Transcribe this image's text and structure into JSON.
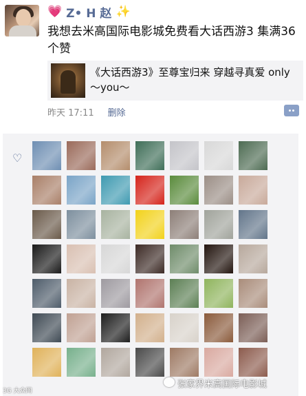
{
  "post": {
    "author": "Z• H 赵",
    "prefix_emoji": "💗",
    "suffix_emoji": "✨",
    "text": "我想去米高国际电影城免费看大话西游3  集满36个赞",
    "link": {
      "title": "《大话西游3》至尊宝归来  穿越寻真爱 only～you～"
    },
    "time": "昨天 17:11",
    "delete_label": "删除"
  },
  "likes": {
    "icon": "heart-outline-icon",
    "avatars": [
      "#6f8fb3",
      "#9a6a5a",
      "#b48d6c",
      "#3f6e58",
      "#c4c4c9",
      "#d8d8d8",
      "#4d6b52",
      "#a97f68",
      "#7aa4c7",
      "#3f9ab1",
      "#d5241b",
      "#5a8b3c",
      "#9b8e86",
      "#c8a99a",
      "#6a5a4a",
      "#7d8f9e",
      "#a8b3a0",
      "#f2d21b",
      "#8d7f78",
      "#a0a39b",
      "#62758a",
      "#1a1a1a",
      "#d9c0b2",
      "#d7d7d7",
      "#3c2a25",
      "#6f8c6a",
      "#23150f",
      "#b7a89c",
      "#4e5c6a",
      "#c9b3a4",
      "#9e9aa0",
      "#b0746e",
      "#5c7f54",
      "#8fb45d",
      "#a98c7a",
      "#3f4a54",
      "#c0a193",
      "#1e1e1e",
      "#d2b08c",
      "#d8d2ca",
      "#8a5a3b",
      "#7b5e56",
      "#e0b25a",
      "#77b08c",
      "#b1a79e",
      "#4a4a4a",
      "#9e7a64",
      "#d9a9a0",
      "#8c5b4d"
    ]
  },
  "watermark": "张家界米高国际电影城",
  "corner_mark": "3G 大众网"
}
